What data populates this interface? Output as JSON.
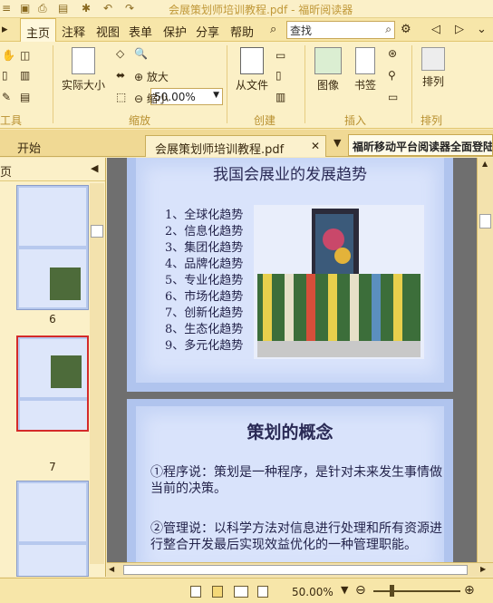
{
  "titlebar": {
    "title": "会展策划师培训教程.pdf - 福昕阅读器"
  },
  "menu": {
    "home": "主页",
    "annotate": "注释",
    "view": "视图",
    "form": "表单",
    "protect": "保护",
    "share": "分享",
    "help": "帮助",
    "search_value": "查找"
  },
  "ribbon": {
    "actual_size": "实际大小",
    "zoom_value": "50.00%",
    "zoom_in": "放大",
    "zoom_out": "缩小",
    "from_file": "从文件",
    "image": "图像",
    "bookmark": "书签",
    "arrange": "排列",
    "groups": {
      "tools": "工具",
      "zoom": "缩放",
      "create": "创建",
      "insert": "插入",
      "arrange": "排列"
    }
  },
  "tabs": {
    "start": "开始",
    "document": "会展策划师培训教程.pdf",
    "banner": "福昕移动平台阅读器全面登陆"
  },
  "panel": {
    "title": "页",
    "pages": [
      "6",
      "7"
    ]
  },
  "slides": {
    "s1_title": "我国会展业的发展趋势",
    "s1_items": [
      "1、全球化趋势",
      "2、信息化趋势",
      "3、集团化趋势",
      "4、品牌化趋势",
      "5、专业化趋势",
      "6、市场化趋势",
      "7、创新化趋势",
      "8、生态化趋势",
      "9、多元化趋势"
    ],
    "s2_title": "策划的概念",
    "s2_p1": "①程序说：策划是一种程序，是针对未来发生事情做当前的决策。",
    "s2_p2": "②管理说：以科学方法对信息进行处理和所有资源进行整合开发最后实现效益优化的一种管理职能。"
  },
  "status": {
    "zoom": "50.00%"
  }
}
